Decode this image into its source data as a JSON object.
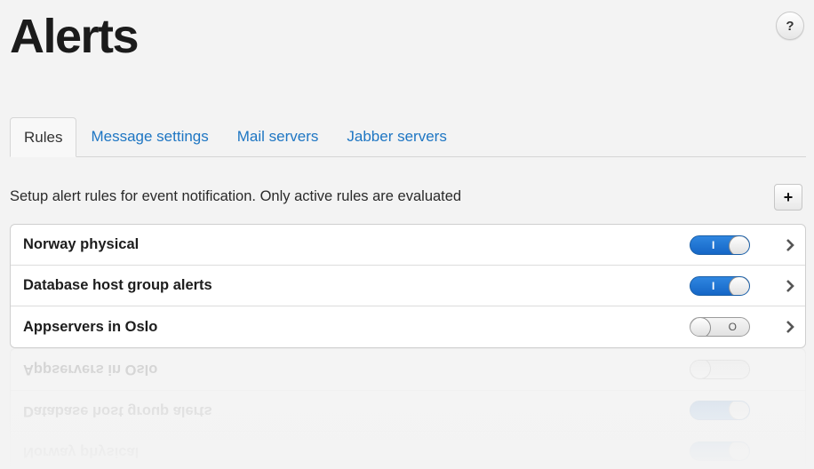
{
  "page": {
    "title": "Alerts",
    "help_label": "?"
  },
  "tabs": [
    {
      "label": "Rules",
      "active": true
    },
    {
      "label": "Message settings",
      "active": false
    },
    {
      "label": "Mail servers",
      "active": false
    },
    {
      "label": "Jabber servers",
      "active": false
    }
  ],
  "description": "Setup alert rules for event notification. Only active rules are evaluated",
  "add_label": "+",
  "rules": [
    {
      "name": "Norway physical",
      "active": true,
      "toggle_mark": "I"
    },
    {
      "name": "Database host group alerts",
      "active": true,
      "toggle_mark": "I"
    },
    {
      "name": "Appservers in Oslo",
      "active": false,
      "toggle_mark": "O"
    }
  ],
  "colors": {
    "accent": "#1e76c3",
    "toggle_on": "#1f74d2",
    "background": "#f3f3f3"
  }
}
